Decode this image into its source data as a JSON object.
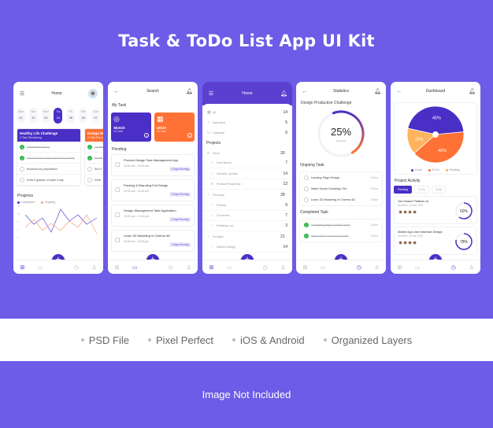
{
  "hero": {
    "title": "Task & ToDo List App UI Kit"
  },
  "colors": {
    "background": "#6C5CE7",
    "primary": "#4A2FC6",
    "accent": "#FF7134",
    "pending": "#FFB35C",
    "success": "#2DB84C"
  },
  "screens": {
    "home": {
      "title": "Home",
      "menu_icon": "hamburger-icon",
      "days": [
        {
          "name": "Mon",
          "num": "21"
        },
        {
          "name": "Tue",
          "num": "22"
        },
        {
          "name": "Wed",
          "num": "23"
        },
        {
          "name": "Thu",
          "num": "24",
          "selected": true
        },
        {
          "name": "Fri",
          "num": "25"
        },
        {
          "name": "Sat",
          "num": "26"
        },
        {
          "name": "Sun",
          "num": "27"
        }
      ],
      "challenges": [
        {
          "title": "Healthy Life Challenge",
          "subtitle": "4 Task Remaining",
          "color": "#4A2FC6",
          "items": [
            {
              "label": "Intermittent fasting",
              "done": true
            },
            {
              "label": "Get in 8 hours sleep and wake up early",
              "done": true
            },
            {
              "label": "Business trip preparation",
              "done": false
            },
            {
              "label": "Drink 8 glasses of water a day",
              "done": false
            }
          ]
        },
        {
          "title": "Design Mar",
          "subtitle": "4 Task Remai",
          "color": "#FF7134",
          "items": [
            {
              "label": "Landing",
              "done": true
            },
            {
              "label": "Mobile",
              "done": true
            },
            {
              "label": "Run 5",
              "done": false
            },
            {
              "label": "Drink",
              "done": false
            }
          ]
        }
      ],
      "progress": {
        "title": "Progress",
        "legend": [
          {
            "label": "Completed",
            "color": "#4A2FC6"
          },
          {
            "label": "Ongoing",
            "color": "#F0A27A"
          }
        ]
      }
    },
    "search": {
      "title": "Search",
      "my_task_label": "My Task",
      "task_cards": [
        {
          "name": "Sketch",
          "count": "10 Task",
          "color": "#4A2FC6",
          "icon": "sketch-icon"
        },
        {
          "name": "UI/UX",
          "count": "30 Task",
          "color": "#FF7134",
          "icon": "layout-icon"
        }
      ],
      "pending_label": "Pending",
      "pending": [
        {
          "title": "Product Design Task Management App",
          "time": "10:00 am - 10:30 am",
          "badge": "4 Days Running"
        },
        {
          "title": "Packing & Branding Full Design",
          "time": "10:00 pm - 14:00 pm",
          "badge": "3 Days Running"
        },
        {
          "title": "Design Management Task Application",
          "time": "10:00 pm - 12:40 pm",
          "badge": "2 Days Running"
        },
        {
          "title": "Learn 3D Modeling in Cinema 4D",
          "time": "16:00 pm - 18:00 pm",
          "badge": "1 Days Running"
        }
      ]
    },
    "menu": {
      "title": "Home",
      "rows": [
        {
          "label": "All",
          "count": "14",
          "icon": "grid-icon"
        },
        {
          "label": "Important",
          "count": "5",
          "icon": "star-icon"
        },
        {
          "label": "Calendar",
          "count": "0",
          "icon": "calendar-icon"
        }
      ],
      "projects_label": "Projects",
      "groups": [
        {
          "label": "Work",
          "count": "30",
          "color": "#4A2FC6",
          "children": [
            {
              "label": "New Brand",
              "count": "7",
              "color": "#FF7134"
            },
            {
              "label": "Website Update",
              "count": "14",
              "color": "#FFB35C"
            },
            {
              "label": "Product Roadmap",
              "count": "13",
              "color": "#4A2FC6"
            }
          ]
        },
        {
          "label": "Personal",
          "count": "28",
          "color": "#bbb",
          "children": [
            {
              "label": "Fitness",
              "count": "9",
              "color": "#bbb"
            },
            {
              "label": "Groceries",
              "count": "7",
              "color": "#bbb"
            },
            {
              "label": "Reading List",
              "count": "3",
              "color": "#bbb"
            }
          ]
        },
        {
          "label": "Designs",
          "count": "21",
          "color": "#bbb",
          "children": [
            {
              "label": "Mobile Design",
              "count": "14",
              "color": "#bbb"
            }
          ]
        }
      ]
    },
    "statistics": {
      "title": "Statistics",
      "challenge": "Design Productive Challenge",
      "percent": 25,
      "percent_label": "25%",
      "complete_label": "Complete",
      "ongoing_label": "Ongoing Task",
      "ongoing": [
        {
          "label": "Landing Page Design",
          "date": "13 Mar"
        },
        {
          "label": "Make Sports Drawings Set",
          "date": "13 Mar"
        },
        {
          "label": "Learn 3D Modeling in Cinema 4D",
          "date": "13 Mar"
        }
      ],
      "completed_label": "Completed Task",
      "completed": [
        {
          "label": "Designing High-Quality Tasks",
          "date": "15 Mar"
        },
        {
          "label": "Make 160 Custom Icon Sets",
          "date": "15 Mar"
        }
      ]
    },
    "dashboard": {
      "title": "Dashboard",
      "pie": [
        {
          "label": "Done",
          "value": 45,
          "color": "#4A2FC6"
        },
        {
          "label": "To Do",
          "value": 40,
          "color": "#FF7134"
        },
        {
          "label": "Pending",
          "value": 15,
          "color": "#FFB35C"
        }
      ],
      "activity_label": "Project Activity",
      "tabs": [
        {
          "label": "Pending",
          "active": true
        },
        {
          "label": "To Do"
        },
        {
          "label": "Done"
        }
      ],
      "projects": [
        {
          "title": "Job Search Platform UI",
          "deadline": "Deadline: 14 Mar 2022",
          "percent": 60,
          "percent_label": "60%"
        },
        {
          "title": "Mobile App User Interface Design",
          "deadline": "Deadline: 18 Mar 2022",
          "percent": 78,
          "percent_label": "78%"
        }
      ]
    }
  },
  "features": [
    "PSD File",
    "Pixel Perfect",
    "iOS & Android",
    "Organized Layers"
  ],
  "footer": "Image Not Included"
}
